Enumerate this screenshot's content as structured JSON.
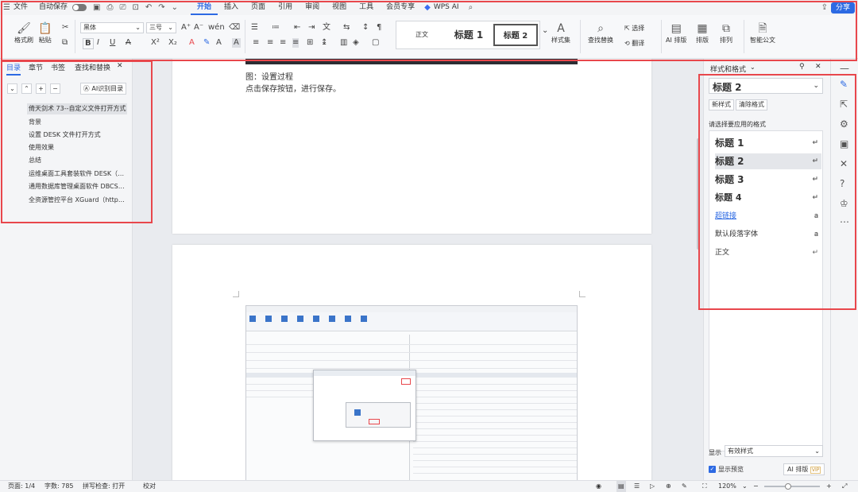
{
  "menubar": {
    "file": "文件",
    "autosave": "自动保存",
    "tabs": [
      "开始",
      "插入",
      "页面",
      "引用",
      "审阅",
      "视图",
      "工具",
      "会员专享",
      "WPS AI"
    ],
    "share": "分享"
  },
  "ribbon": {
    "format_painter": "格式刷",
    "paste": "粘贴",
    "font_name": "黑体",
    "font_size": "三号",
    "styles_gallery": [
      "正文",
      "标题 1",
      "标题 2"
    ],
    "style_set": "样式集",
    "find_replace": "查找替换",
    "select": "选择",
    "translate": "翻译",
    "ai_layout": "AI 排版",
    "layout": "排版",
    "arrange": "排列",
    "smart_doc": "智能公文"
  },
  "leftpanel": {
    "tabs": [
      "目录",
      "章节",
      "书签",
      "查找和替换"
    ],
    "ai_toc": "AI识别目录",
    "items": [
      "倚天剑术 73--自定义文件打开方式",
      "背景",
      "设置 DESK 文件打开方式",
      "使用效果",
      "总结",
      "运维桌面工具套装软件 DESK（ht…",
      "通用数据库管理桌面软件 DBCS…",
      "全资源管控平台 XGuard（https:…"
    ]
  },
  "document": {
    "caption": "图：设置过程",
    "line2": "点击保存按钮，进行保存。"
  },
  "rightpanel": {
    "title": "样式和格式",
    "current_style": "标题 2",
    "new_style": "新样式",
    "clear_format": "清除格式",
    "prompt": "请选择要应用的格式",
    "styles": [
      "标题 1",
      "标题 2",
      "标题 3",
      "标题 4",
      "超链接",
      "默认段落字体",
      "正文"
    ],
    "show_label": "显示",
    "show_value": "有效样式",
    "preview": "显示预览",
    "ai_layout": "AI 排版",
    "vip": "VIP"
  },
  "statusbar": {
    "page": "页面: 1/4",
    "words": "字数: 785",
    "spell": "拼写检查: 打开",
    "proof": "校对",
    "zoom": "120%"
  },
  "colors": {
    "accent": "#2d6ae3",
    "annotation": "#e8474c"
  }
}
